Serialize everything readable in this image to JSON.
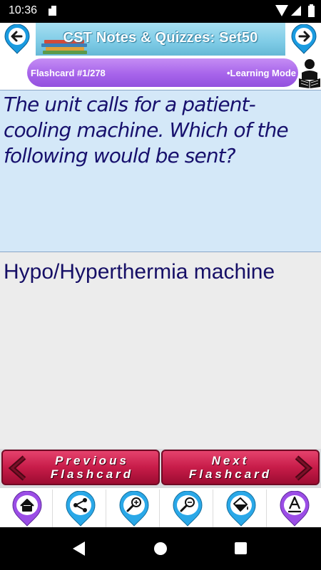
{
  "status_bar": {
    "time": "10:36",
    "icons": [
      "sd-card-icon",
      "wifi-icon",
      "signal-icon",
      "battery-icon"
    ]
  },
  "header": {
    "title": "CST Notes & Quizzes: Set50",
    "prev_icon": "arrow-left-icon",
    "next_icon": "arrow-right-icon"
  },
  "info_bar": {
    "counter": "Flashcard #1/278",
    "mode": "•Learning Mode",
    "accent": "#a764ea"
  },
  "question": {
    "text": "The unit calls for a patient-cooling machine. Which of the following would be sent?"
  },
  "answer": {
    "text": "Hypo/Hyperthermia machine"
  },
  "actions": {
    "previous": {
      "line1": "Previous",
      "line2": "Flashcard"
    },
    "next": {
      "line1": "Next",
      "line2": "Flashcard"
    },
    "color": "#c71c49"
  },
  "toolbar": {
    "items": [
      {
        "name": "home-icon",
        "color": "#9b4de6"
      },
      {
        "name": "share-icon",
        "color": "#2aa8e8"
      },
      {
        "name": "zoom-in-icon",
        "color": "#2aa8e8"
      },
      {
        "name": "zoom-out-icon",
        "color": "#2aa8e8"
      },
      {
        "name": "paint-bucket-icon",
        "color": "#2aa8e8"
      },
      {
        "name": "text-style-icon",
        "color": "#9b4de6"
      }
    ]
  },
  "navbar": {
    "buttons": [
      "back-icon",
      "home-circle-icon",
      "recents-icon"
    ]
  }
}
